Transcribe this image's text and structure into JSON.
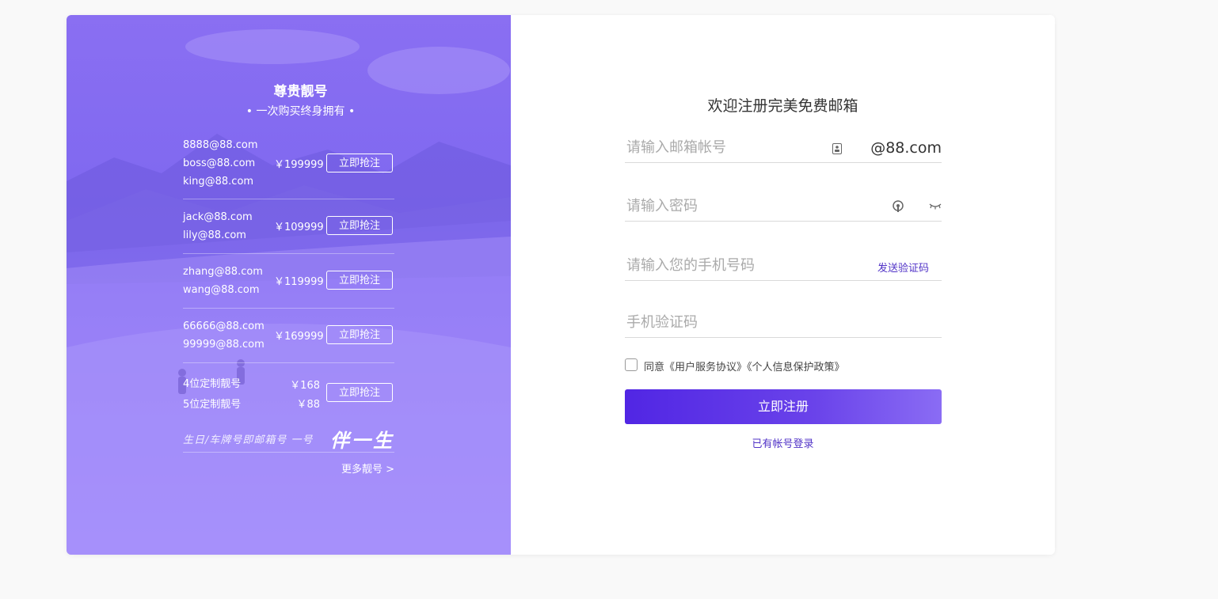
{
  "promo": {
    "title": "尊贵靓号",
    "subtitle": "• 一次购买终身拥有 •",
    "groups": [
      {
        "names": [
          "8888@88.com",
          "boss@88.com",
          "king@88.com"
        ],
        "price": "￥199999",
        "button": "立即抢注"
      },
      {
        "names": [
          "jack@88.com",
          "lily@88.com"
        ],
        "price": "￥109999",
        "button": "立即抢注"
      },
      {
        "names": [
          "zhang@88.com",
          "wang@88.com"
        ],
        "price": "￥119999",
        "button": "立即抢注"
      },
      {
        "names": [
          "66666@88.com",
          "99999@88.com"
        ],
        "price": "￥169999",
        "button": "立即抢注"
      }
    ],
    "custom": {
      "items": [
        {
          "name": "4位定制靓号",
          "price": "￥168"
        },
        {
          "name": "5位定制靓号",
          "price": "￥88"
        }
      ],
      "button": "立即抢注"
    },
    "slogan_left": "生日/车牌号即邮箱号  一号",
    "slogan_right": "伴一生",
    "more": "更多靓号 >"
  },
  "form": {
    "title": "欢迎注册完美免费邮箱",
    "email_placeholder": "请输入邮箱帐号",
    "email_suffix": "@88.com",
    "password_placeholder": "请输入密码",
    "phone_placeholder": "请输入您的手机号码",
    "send_code": "发送验证码",
    "code_placeholder": "手机验证码",
    "agree_text": "同意《用户服务协议》《个人信息保护政策》",
    "submit": "立即注册",
    "login_link": "已有帐号登录"
  },
  "colors": {
    "accent": "#5133c7",
    "button_start": "#5126e4",
    "button_end": "#8a6cf4",
    "panel": "#8a6ff2"
  }
}
